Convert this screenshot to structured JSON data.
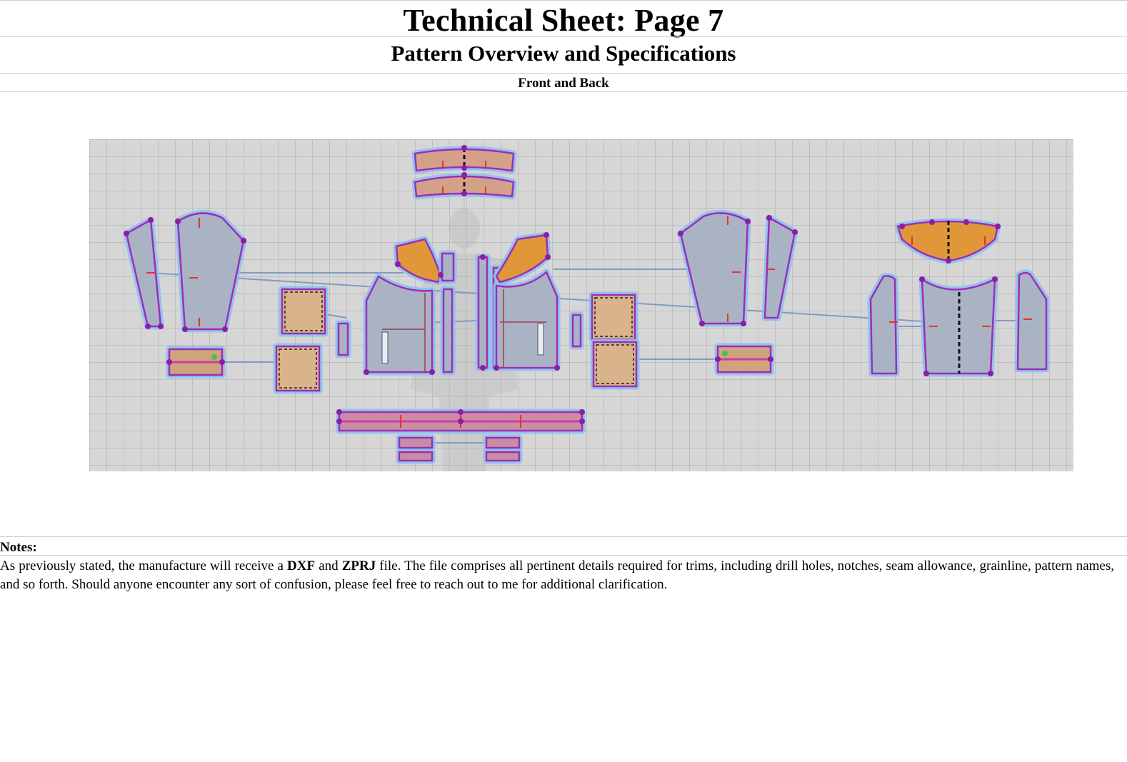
{
  "header": {
    "title": "Technical Sheet: Page 7",
    "subtitle": "Pattern Overview and Specifications",
    "section": "Front and Back"
  },
  "notes": {
    "label": "Notes:",
    "text_1": "As previously stated, the manufacture will receive a ",
    "file_1": "DXF",
    "text_2": " and ",
    "file_2": "ZPRJ",
    "text_3": " file. The file comprises all pertinent details required for trims, including drill holes, notches, seam allowance, grainline, pattern names, and so forth. Should anyone encounter any sort of confusion, please feel free to reach out to me for additional clarification."
  },
  "colors": {
    "canvas": "#d6d6d6",
    "piece_fill": "#a9b3c4",
    "piece_outline": "#9a2fb8",
    "piece_halo": "#8fc0ee",
    "accent_piece": "#e0973a",
    "notch": "#e8312a"
  }
}
